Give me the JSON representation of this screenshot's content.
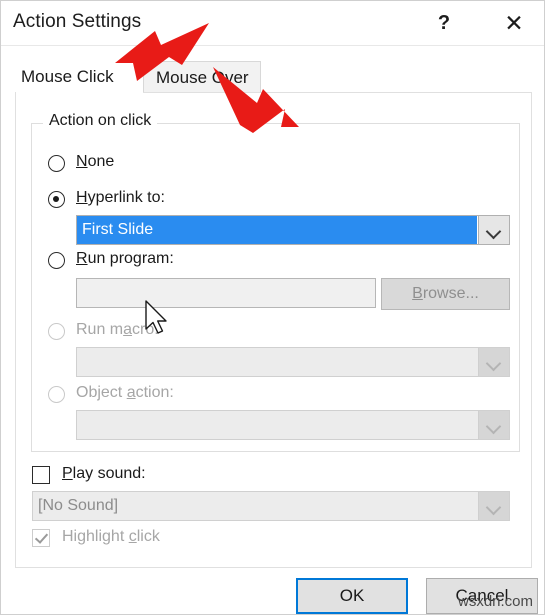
{
  "window": {
    "title": "Action Settings",
    "help_label": "?",
    "close_label": "✕"
  },
  "tabs": [
    {
      "label": "Mouse Click",
      "active": true
    },
    {
      "label": "Mouse Over",
      "active": false
    }
  ],
  "group": {
    "legend": "Action on click"
  },
  "options": [
    {
      "id": "none",
      "label_pre": "",
      "label_key": "N",
      "label_post": "one",
      "selected": false,
      "disabled": false
    },
    {
      "id": "hyperlink",
      "label_pre": "",
      "label_key": "H",
      "label_post": "yperlink to:",
      "selected": true,
      "disabled": false
    },
    {
      "id": "run-program",
      "label_pre": "",
      "label_key": "R",
      "label_post": "un program:",
      "selected": false,
      "disabled": false
    },
    {
      "id": "run-macro",
      "label_pre": "Run m",
      "label_key": "a",
      "label_post": "cro:",
      "selected": false,
      "disabled": true
    },
    {
      "id": "object-action",
      "label_pre": "Object ",
      "label_key": "a",
      "label_post": "ction:",
      "selected": false,
      "disabled": true
    }
  ],
  "hyperlink_combo": {
    "value": "First Slide",
    "selected_highlight": true,
    "highlight_color": "#2a8cf0"
  },
  "run_program": {
    "value": "",
    "browse_label": "Browse...",
    "browse_key": "B",
    "browse_disabled": true
  },
  "run_macro_combo": {
    "value": "",
    "disabled": true
  },
  "object_action_combo": {
    "value": "",
    "disabled": true
  },
  "play_sound": {
    "label_pre": "",
    "label_key": "P",
    "label_post": "lay sound:",
    "checked": false,
    "disabled": false,
    "sound_value": "[No Sound]",
    "sound_disabled": true
  },
  "highlight_click": {
    "label_pre": "Highlight ",
    "label_key": "c",
    "label_post": "lick",
    "checked": true,
    "disabled": true
  },
  "buttons": {
    "ok": "OK",
    "cancel": "Cancel"
  },
  "watermark": "wsxdn.com",
  "annotations": {
    "arrow_color": "#e81b17",
    "arrow_1_target": "Mouse Click",
    "arrow_2_target": "Mouse Over"
  }
}
